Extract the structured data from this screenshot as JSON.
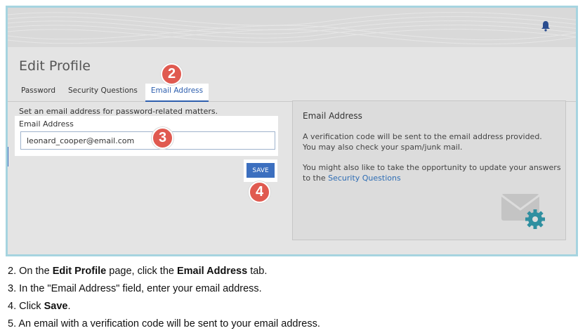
{
  "screenshot": {
    "title": "Edit Profile",
    "tabs": [
      {
        "label": "Password"
      },
      {
        "label": "Security Questions"
      },
      {
        "label": "Email Address",
        "active": true
      }
    ],
    "intro_text": "Set an email address for password-related matters.",
    "email_field": {
      "label": "Email Address",
      "value": "leonard_cooper@email.com"
    },
    "save_label": "SAVE",
    "info_panel": {
      "title": "Email Address",
      "paragraph1": "A verification code will be sent to the email address provided. You may also check your spam/junk mail.",
      "paragraph2_prefix": "You might also like to take the opportunity to update your answers to the ",
      "paragraph2_link": "Security Questions"
    },
    "badges": [
      "2",
      "3",
      "4"
    ],
    "icons": [
      "bell-icon",
      "mail-gear-icon"
    ],
    "colors": {
      "accent": "#3c6fbf",
      "badge": "#e05a50",
      "frame_border": "#a6d4e0",
      "link": "#2e6db4"
    }
  },
  "instructions": [
    {
      "num": "2.",
      "pre": "On the ",
      "b1": "Edit Profile",
      "mid": " page, click the ",
      "b2": "Email Address",
      "post": " tab."
    },
    {
      "num": "3.",
      "text": "In the \"Email Address\" field, enter your email address."
    },
    {
      "num": "4.",
      "pre": "Click ",
      "b1": "Save",
      "post": "."
    },
    {
      "num": "5.",
      "text": "An email with a verification code will be sent to your email address."
    }
  ]
}
